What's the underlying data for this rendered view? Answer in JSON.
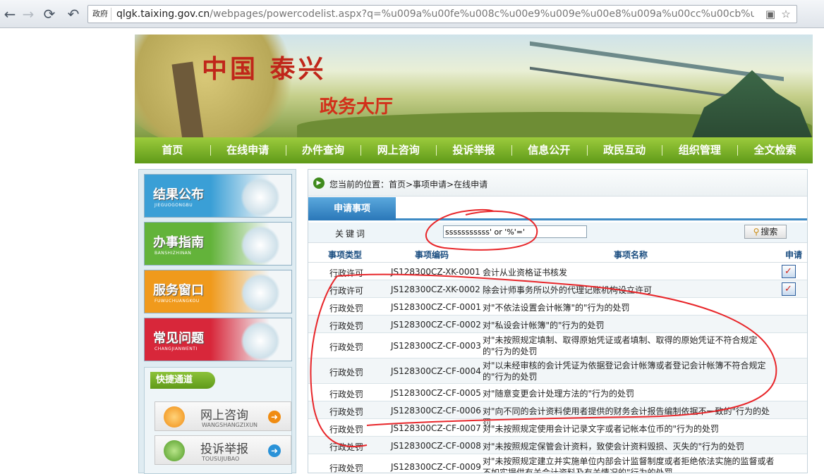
{
  "browser": {
    "url_tag": "政府",
    "url_host": "qlgk.taixing.gov.cn",
    "url_path": "/webpages/powercodelist.aspx?q=%u009a%u00fe%u008c%u00e9%u009e%u00e8%u009a%u00cc%u00cb%u0"
  },
  "header": {
    "logo_text": "中国 泰兴",
    "title": "政务大厅"
  },
  "nav": {
    "items": [
      "首页",
      "在线申请",
      "办件查询",
      "网上咨询",
      "投诉举报",
      "信息公开",
      "政民互动",
      "组织管理",
      "全文检索"
    ]
  },
  "sidebar": {
    "promos": [
      {
        "title": "结果公布",
        "sub": "JIEGUOGONGBU",
        "color": "#3a9fd6"
      },
      {
        "title": "办事指南",
        "sub": "BANSHIZHINAN",
        "color": "#63b33a"
      },
      {
        "title": "服务窗口",
        "sub": "FUWUCHUANGKOU",
        "color": "#f09a1c"
      },
      {
        "title": "常见问题",
        "sub": "CHANGJIANWENTI",
        "color": "#d8273a"
      }
    ],
    "quick": {
      "header": "快捷通道",
      "items": [
        {
          "title": "网上咨询",
          "sub": "WANGSHANGZIXUN",
          "arrow_color": "#f08c12"
        },
        {
          "title": "投诉举报",
          "sub": "TOUSUJUBAO",
          "arrow_color": "#2a92d8"
        }
      ]
    }
  },
  "main": {
    "breadcrumb": "您当前的位置：首页>事项申请>在线申请",
    "tab": "申请事项",
    "search": {
      "label": "关键词",
      "value": "sssssssssss' or '%'='",
      "button": "搜索"
    },
    "columns": [
      "事项类型",
      "事项编码",
      "事项名称",
      "申请"
    ],
    "rows": [
      {
        "type": "行政许可",
        "code": "JS128300CZ-XK-0001",
        "name": "会计从业资格证书核发",
        "apply": true
      },
      {
        "type": "行政许可",
        "code": "JS128300CZ-XK-0002",
        "name": "除会计师事务所以外的代理记账机构设立许可",
        "apply": true
      },
      {
        "type": "行政处罚",
        "code": "JS128300CZ-CF-0001",
        "name": "对\"不依法设置会计帐簿\"的\"行为的处罚",
        "apply": false
      },
      {
        "type": "行政处罚",
        "code": "JS128300CZ-CF-0002",
        "name": "对\"私设会计帐簿\"的\"行为的处罚",
        "apply": false
      },
      {
        "type": "行政处罚",
        "code": "JS128300CZ-CF-0003",
        "name": "对\"未按照规定填制、取得原始凭证或者填制、取得的原始凭证不符合规定的\"行为的处罚",
        "apply": false
      },
      {
        "type": "行政处罚",
        "code": "JS128300CZ-CF-0004",
        "name": "对\"以未经审核的会计凭证为依据登记会计帐簿或者登记会计帐簿不符合规定的\"行为的处罚",
        "apply": false
      },
      {
        "type": "行政处罚",
        "code": "JS128300CZ-CF-0005",
        "name": "对\"随意变更会计处理方法的\"行为的处罚",
        "apply": false
      },
      {
        "type": "行政处罚",
        "code": "JS128300CZ-CF-0006",
        "name": "对\"向不同的会计资料使用者提供的财务会计报告编制依据不一致的\"行为的处罚",
        "apply": false
      },
      {
        "type": "行政处罚",
        "code": "JS128300CZ-CF-0007",
        "name": "对\"未按照规定使用会计记录文字或者记帐本位币的\"行为的处罚",
        "apply": false
      },
      {
        "type": "行政处罚",
        "code": "JS128300CZ-CF-0008",
        "name": "对\"未按照规定保管会计资料，致使会计资料毁损、灭失的\"行为的处罚",
        "apply": false
      },
      {
        "type": "行政处罚",
        "code": "JS128300CZ-CF-0009",
        "name": "对\"未按照规定建立并实施单位内部会计监督制度或者拒绝依法实施的监督或者不如实提供有关会计资料及有关情况的\"行为的处罚",
        "apply": false
      }
    ]
  },
  "annotation_color": "#e8262a"
}
